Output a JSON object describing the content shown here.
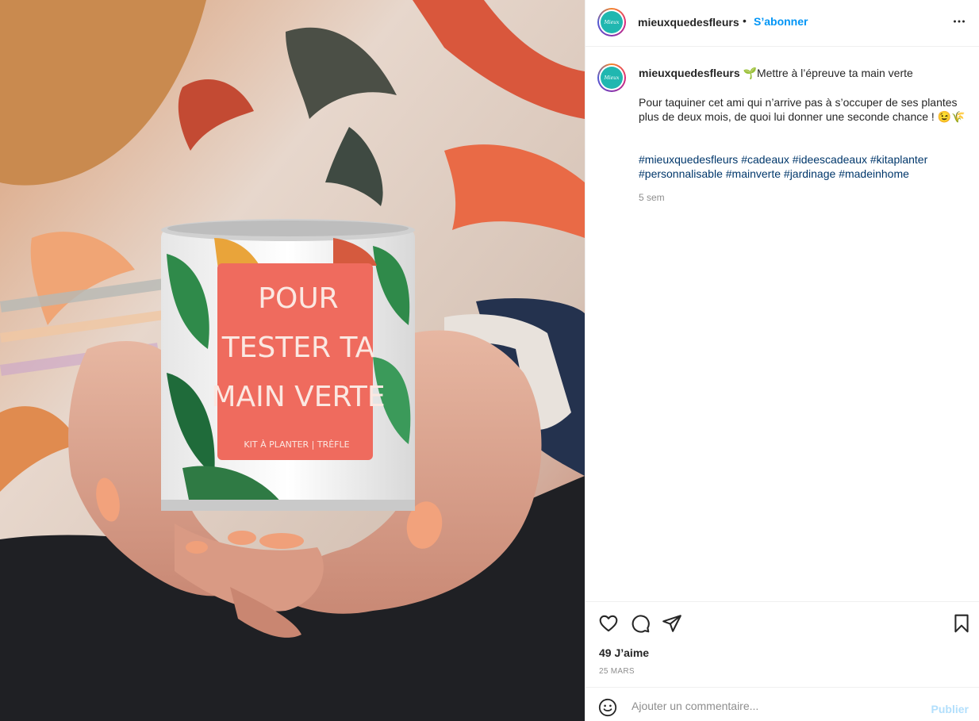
{
  "colors": {
    "accent": "#0095f6",
    "hashtag": "#00376b",
    "muted": "#8e8e8e",
    "publish_disabled": "#b2dffc",
    "can_label": "#ef6b5e",
    "logo_bg": "#20b7b0"
  },
  "post_image": {
    "can_label_lines": [
      "POUR",
      "TESTER TA",
      "MAIN VERTE"
    ],
    "can_label_small": "KIT À PLANTER | TRÈFLE"
  },
  "header": {
    "username": "mieuxquedesfleurs",
    "separator": "•",
    "follow_label": "S’abonner",
    "more_icon": "more-horizontal-icon"
  },
  "avatar": {
    "logo_text": "Mieux"
  },
  "caption": {
    "username": "mieuxquedesfleurs",
    "title_emoji": "🌱",
    "title": "Mettre à l’épreuve ta main verte",
    "body": "Pour taquiner cet ami qui n’arrive pas à s’occuper de ses plantes plus de deux mois, de quoi lui donner une seconde chance ! 😉🌾",
    "hashtags": [
      "#mieuxquedesfleurs",
      "#cadeaux",
      "#ideescadeaux",
      "#kitaplanter",
      "#personnalisable",
      "#mainverte",
      "#jardinage",
      "#madeinhome"
    ],
    "age": "5 sem"
  },
  "actions": {
    "icons": [
      "heart-icon",
      "comment-icon",
      "share-icon",
      "bookmark-icon"
    ],
    "likes": "49 J’aime",
    "date": "25 MARS"
  },
  "comment": {
    "placeholder": "Ajouter un commentaire...",
    "publish_label": "Publier",
    "emoji_icon": "smiley-icon"
  }
}
